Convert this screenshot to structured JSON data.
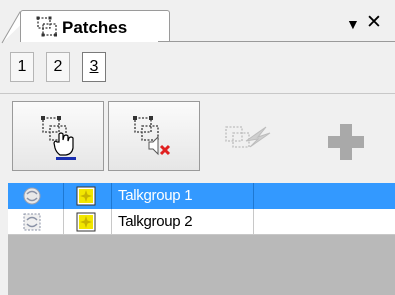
{
  "panel": {
    "title": "Patches",
    "controls": {
      "pin_icon": "dropdown-pin-icon",
      "close_icon": "close-icon"
    }
  },
  "pages": [
    {
      "label": "1",
      "selected": false
    },
    {
      "label": "2",
      "selected": false
    },
    {
      "label": "3",
      "selected": true
    }
  ],
  "toolbar": [
    {
      "icon": "select-patch-hand-icon",
      "enabled": true
    },
    {
      "icon": "delete-patch-icon",
      "enabled": true
    },
    {
      "icon": "patch-lightning-icon",
      "enabled": false
    },
    {
      "icon": "add-icon",
      "enabled": false
    }
  ],
  "list": {
    "rows": [
      {
        "status_icon": "patch-status-icon",
        "type_icon": "talkgroup-star-icon",
        "name": "Talkgroup 1",
        "selected": true
      },
      {
        "status_icon": "patch-status-icon",
        "type_icon": "talkgroup-star-icon",
        "name": "Talkgroup 2",
        "selected": false
      }
    ]
  },
  "colors": {
    "selection": "#3399ff",
    "grid_empty": "#b9b9b9",
    "delete_red": "#e02020",
    "hand_underline": "#1a2fb0",
    "star_yellow": "#f2e600"
  }
}
